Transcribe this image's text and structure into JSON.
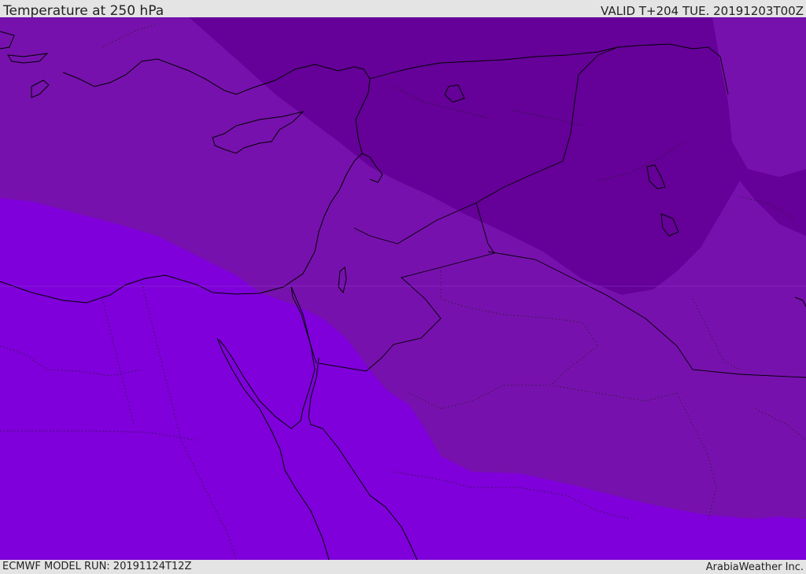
{
  "header": {
    "title": "Temperature at 250 hPa",
    "valid_time": "VALID T+204 TUE. 20191203T00Z"
  },
  "footer": {
    "model_run": "ECMWF MODEL RUN: 20191124T12Z",
    "credit": "ArabiaWeather Inc."
  },
  "map": {
    "colors": {
      "coldest": "#650098",
      "cold": "#7711ad",
      "warm": "#7f00db",
      "coastline": "#000000"
    }
  }
}
